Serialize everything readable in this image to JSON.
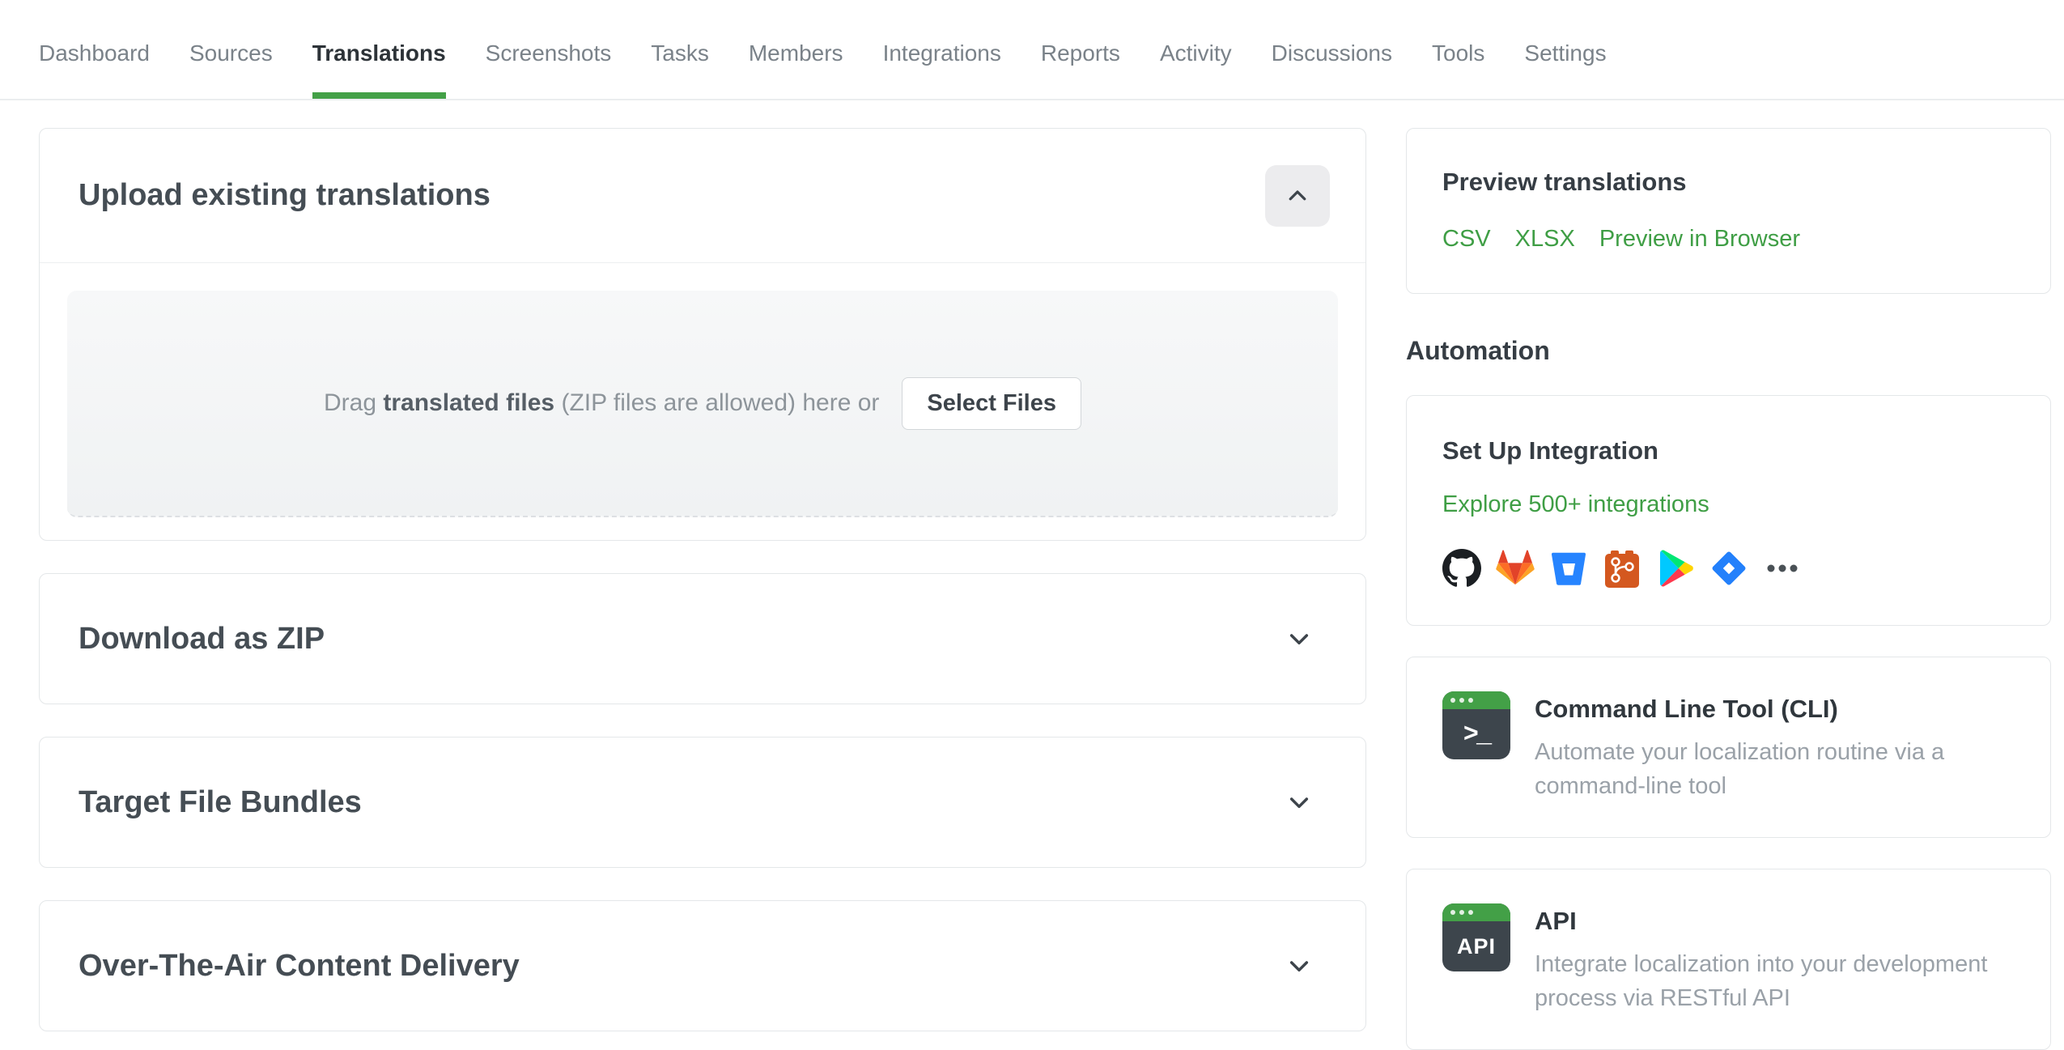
{
  "nav": {
    "tabs": [
      "Dashboard",
      "Sources",
      "Translations",
      "Screenshots",
      "Tasks",
      "Members",
      "Integrations",
      "Reports",
      "Activity",
      "Discussions",
      "Tools",
      "Settings"
    ],
    "active_tab": "Translations"
  },
  "upload_card": {
    "title": "Upload existing translations",
    "collapse_icon": "chevron-up-icon",
    "dropzone": {
      "drag_prefix": "Drag",
      "drag_bold": "translated files",
      "drag_suffix": "(ZIP files are allowed) here or",
      "select_button": "Select Files"
    }
  },
  "collapsed_cards": [
    {
      "title": "Download as ZIP",
      "icon": "chevron-down-icon"
    },
    {
      "title": "Target File Bundles",
      "icon": "chevron-down-icon"
    },
    {
      "title": "Over-The-Air Content Delivery",
      "icon": "chevron-down-icon"
    }
  ],
  "sidebar": {
    "preview": {
      "title": "Preview translations",
      "links": [
        "CSV",
        "XLSX",
        "Preview in Browser"
      ]
    },
    "automation_heading": "Automation",
    "integration": {
      "title": "Set Up Integration",
      "link": "Explore 500+ integrations",
      "icons": [
        "github-icon",
        "gitlab-icon",
        "bitbucket-icon",
        "git-icon",
        "google-play-icon",
        "jira-icon",
        "more-integrations-icon"
      ]
    },
    "cli": {
      "title": "Command Line Tool (CLI)",
      "description": "Automate your localization routine via a command-line tool",
      "icon_glyph": ">_"
    },
    "api": {
      "title": "API",
      "description": "Integrate localization into your development process via RESTful API",
      "icon_glyph": "API"
    }
  },
  "colors": {
    "accent_green": "#43a047",
    "link_green": "#3f9e45",
    "active_tab_text": "#2d3338",
    "inactive_tab_text": "#7a8289",
    "terminal_icon_bg": "#3d454c"
  }
}
